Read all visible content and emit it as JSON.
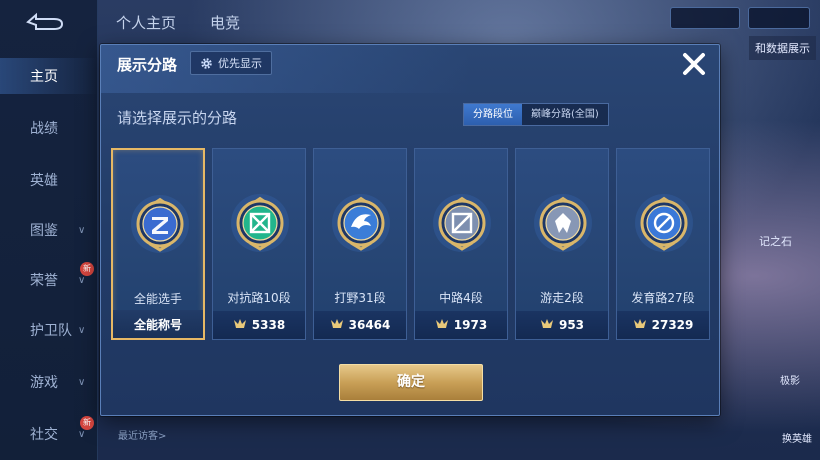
{
  "background": {
    "top_tabs": [
      "个人主页",
      "电竞"
    ],
    "sidebar": [
      {
        "label": "主页",
        "active": true,
        "chevron": false,
        "new": false
      },
      {
        "label": "战绩",
        "active": false,
        "chevron": false,
        "new": false
      },
      {
        "label": "英雄",
        "active": false,
        "chevron": false,
        "new": false
      },
      {
        "label": "图鉴",
        "active": false,
        "chevron": true,
        "new": false
      },
      {
        "label": "荣誉",
        "active": false,
        "chevron": true,
        "new": true
      },
      {
        "label": "护卫队",
        "active": false,
        "chevron": true,
        "new": false
      },
      {
        "label": "游戏",
        "active": false,
        "chevron": true,
        "new": false
      },
      {
        "label": "社交",
        "active": false,
        "chevron": true,
        "new": true
      }
    ],
    "new_badge": "新",
    "recent_visitors": "最近访客>",
    "right_label_1": "和数据展示",
    "right_label_2": "记之石",
    "bottom_right_1": "极影",
    "bottom_right_2": "换英雄"
  },
  "modal": {
    "title": "展示分路",
    "priority_button": "优先显示",
    "subtitle": "请选择展示的分路",
    "toggle": [
      {
        "label": "分路段位",
        "active": true
      },
      {
        "label": "巅峰分路(全国)",
        "active": false
      }
    ],
    "cards": [
      {
        "name": "全能选手",
        "footer": "全能称号",
        "selected": true,
        "has_points": false,
        "emblem": "all-round-emblem-icon",
        "color": "#3a6bd0"
      },
      {
        "name": "对抗路10段",
        "footer": "5338",
        "selected": false,
        "has_points": true,
        "emblem": "clash-lane-emblem-icon",
        "color": "#22b58c"
      },
      {
        "name": "打野31段",
        "footer": "36464",
        "selected": false,
        "has_points": true,
        "emblem": "jungle-emblem-icon",
        "color": "#3b7dd8"
      },
      {
        "name": "中路4段",
        "footer": "1973",
        "selected": false,
        "has_points": true,
        "emblem": "mid-lane-emblem-icon",
        "color": "#7d8fb0"
      },
      {
        "name": "游走2段",
        "footer": "953",
        "selected": false,
        "has_points": true,
        "emblem": "roam-emblem-icon",
        "color": "#8797b5"
      },
      {
        "name": "发育路27段",
        "footer": "27329",
        "selected": false,
        "has_points": true,
        "emblem": "farm-lane-emblem-icon",
        "color": "#3a78d8"
      }
    ],
    "confirm": "确定"
  },
  "colors": {
    "gold": "#e6b865",
    "modal_bg": "#243f6b",
    "toggle_active": "#3a72c8"
  }
}
